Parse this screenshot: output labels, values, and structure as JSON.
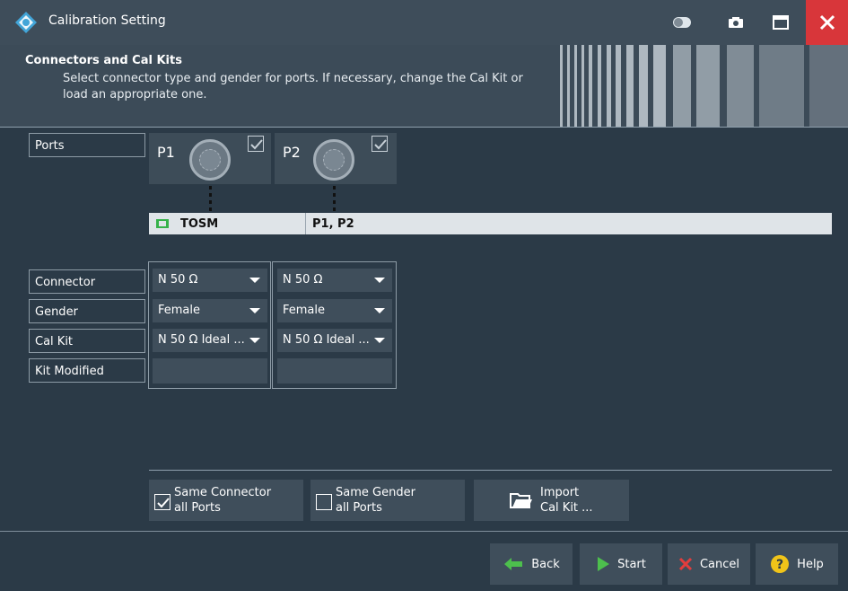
{
  "window": {
    "title": "Calibration Setting",
    "colors": {
      "bg": "#2b3a47",
      "title": "#3e4d5a",
      "close": "#d8363a",
      "accent": "#4dbf4d"
    }
  },
  "header": {
    "title": "Connectors and Cal Kits",
    "description_line1": "Select connector type and gender for ports. If necessary, change the Cal Kit or",
    "description_line2": "load an appropriate one."
  },
  "labels": {
    "ports": "Ports",
    "connector": "Connector",
    "gender": "Gender",
    "cal_kit": "Cal Kit",
    "kit_modified": "Kit Modified"
  },
  "ports": [
    {
      "name": "P1",
      "checked": true
    },
    {
      "name": "P2",
      "checked": true
    }
  ],
  "calibration": {
    "type": "TOSM",
    "ports": "P1, P2"
  },
  "settings": [
    {
      "connector": "N 50 Ω",
      "gender": "Female",
      "cal_kit": "N 50 Ω Ideal ...",
      "kit_modified": ""
    },
    {
      "connector": "N 50 Ω",
      "gender": "Female",
      "cal_kit": "N 50 Ω Ideal ...",
      "kit_modified": ""
    }
  ],
  "options": {
    "same_connector": {
      "line1": "Same Connector",
      "line2": "all Ports",
      "checked": true
    },
    "same_gender": {
      "line1": "Same Gender",
      "line2": "all Ports",
      "checked": false
    },
    "import_cal_kit": {
      "line1": "Import",
      "line2": "Cal Kit ..."
    }
  },
  "footer": {
    "back": "Back",
    "start": "Start",
    "cancel": "Cancel",
    "help": "Help"
  }
}
